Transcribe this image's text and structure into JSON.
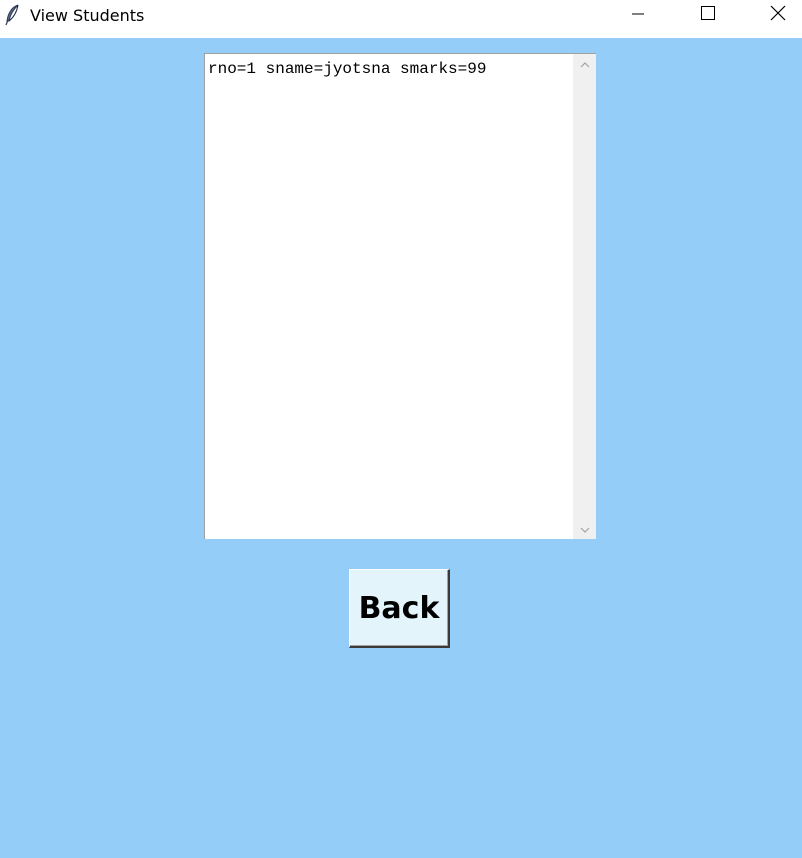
{
  "window": {
    "title": "View Students",
    "app_icon": "feather-icon",
    "controls": {
      "minimize": "minimize-icon",
      "maximize": "maximize-icon",
      "close": "close-icon"
    },
    "background_color": "#94cdf8"
  },
  "records_box": {
    "lines": [
      "rno=1 sname=jyotsna smarks=99"
    ],
    "scrollbar": {
      "up_icon": "chevron-up-icon",
      "down_icon": "chevron-down-icon"
    }
  },
  "back_button": {
    "label": "Back"
  }
}
